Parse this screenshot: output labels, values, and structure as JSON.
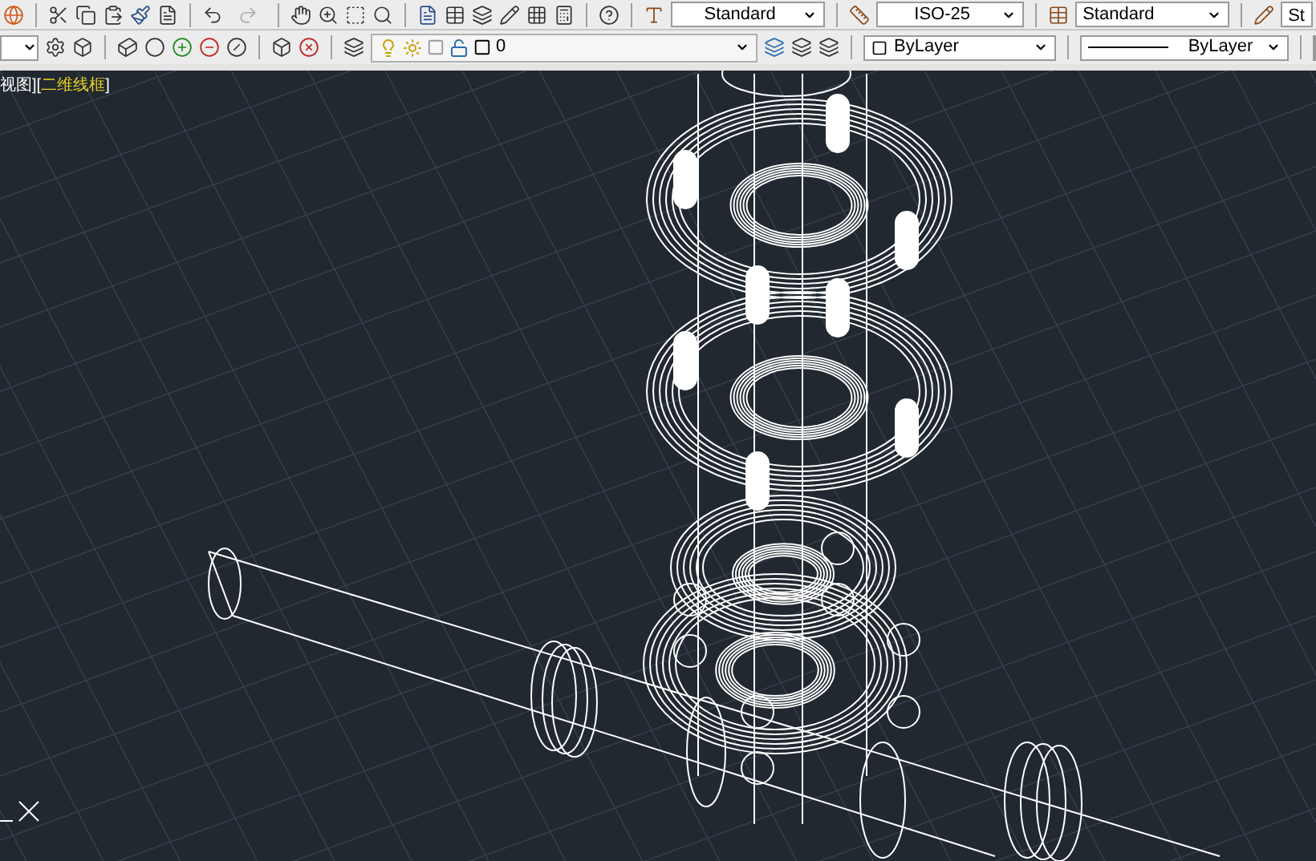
{
  "toolbar_top": {
    "text_style": "Standard",
    "dim_style": "ISO-25",
    "table_style": "Standard",
    "multileader_style": "St"
  },
  "toolbar_layers": {
    "layer_name": "0",
    "swatch_text": "ByLayer",
    "linetype": "ByLayer"
  },
  "viewport": {
    "view_label": "视图][",
    "visual_style": "二维线框",
    "label_end": "]"
  }
}
